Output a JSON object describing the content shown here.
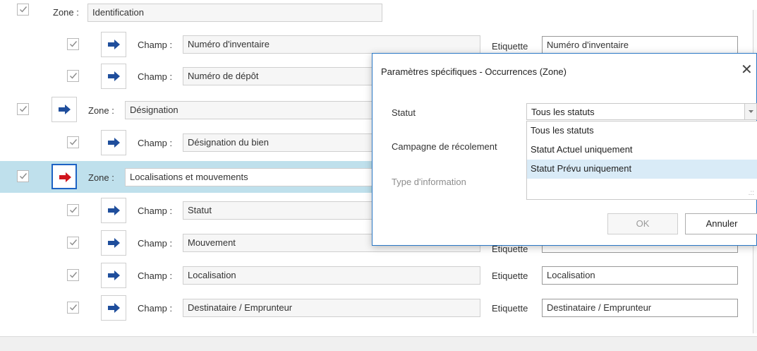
{
  "rows": [
    {
      "kind": "zone",
      "label": "Zone :",
      "value": "Identification"
    },
    {
      "kind": "champ",
      "label": "Champ :",
      "value": "Numéro d'inventaire",
      "etiquette_label": "Etiquette",
      "etiquette": "Numéro d'inventaire"
    },
    {
      "kind": "champ",
      "label": "Champ :",
      "value": "Numéro de dépôt"
    },
    {
      "kind": "zone",
      "label": "Zone :",
      "value": "Désignation"
    },
    {
      "kind": "champ",
      "label": "Champ :",
      "value": "Désignation du bien"
    },
    {
      "kind": "zone",
      "label": "Zone :",
      "value": "Localisations et mouvements"
    },
    {
      "kind": "champ",
      "label": "Champ :",
      "value": "Statut"
    },
    {
      "kind": "champ",
      "label": "Champ :",
      "value": "Mouvement",
      "etiquette_label": "Etiquette"
    },
    {
      "kind": "champ",
      "label": "Champ :",
      "value": "Localisation",
      "etiquette_label": "Etiquette",
      "etiquette": "Localisation"
    },
    {
      "kind": "champ",
      "label": "Champ :",
      "value": "Destinataire / Emprunteur",
      "etiquette_label": "Etiquette",
      "etiquette": "Destinataire / Emprunteur"
    }
  ],
  "dialog": {
    "title": "Paramètres spécifiques - Occurrences (Zone)",
    "close": "✕",
    "statut_label": "Statut",
    "statut_value": "Tous les statuts",
    "campagne_label": "Campagne de récolement",
    "type_label": "Type d'information",
    "options": [
      "Tous les statuts",
      "Statut Actuel uniquement",
      "Statut Prévu uniquement"
    ],
    "highlighted_option": "Statut Prévu uniquement",
    "ok_label": "OK",
    "cancel_label": "Annuler"
  },
  "colors": {
    "accent": "#2b78c6",
    "selected_row": "#bfe0ec",
    "arrow": "#1f4e9c",
    "arrow_active": "#d0151e"
  }
}
